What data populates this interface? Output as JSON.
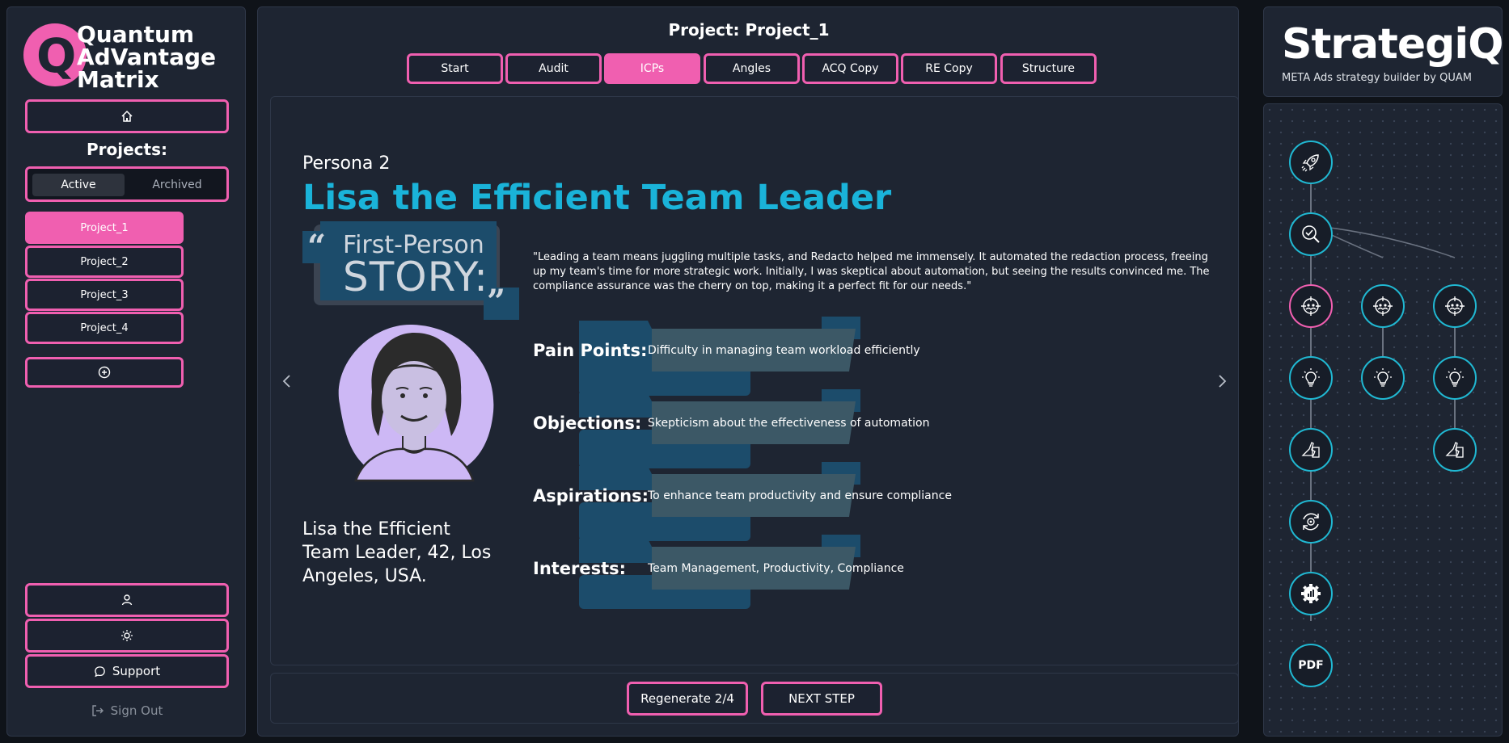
{
  "brand": {
    "line1": "Quantum",
    "line2": "AdVantage",
    "line3": "Matrix",
    "letter": "Q",
    "accent": "#f05fb0"
  },
  "sidebar": {
    "home_icon": "home-icon",
    "projects_heading": "Projects:",
    "toggle": {
      "active": "Active",
      "archived": "Archived"
    },
    "projects": [
      "Project_1",
      "Project_2",
      "Project_3",
      "Project_4"
    ],
    "add_icon": "plus-circle-icon",
    "user_icon": "user-icon",
    "theme_icon": "sun-icon",
    "support": "Support",
    "sign_out": "Sign Out"
  },
  "header": {
    "title": "Project: Project_1",
    "tabs": [
      "Start",
      "Audit",
      "ICPs",
      "Angles",
      "ACQ Copy",
      "RE Copy",
      "Structure"
    ],
    "active_tab": "ICPs"
  },
  "persona": {
    "number_label": "Persona 2",
    "name": "Lisa the Efficient Team Leader",
    "story_top": "First-Person",
    "story_bottom": "STORY:",
    "quote": "\"Leading a team means juggling multiple tasks, and Redacto helped me immensely. It automated the redaction process, freeing up my team's time for more strategic work. Initially, I was skeptical about automation, but seeing the results convinced me. The compliance assurance was the cherry on top, making it a perfect fit for our needs.\"",
    "caption": "Lisa the Efficient Team Leader, 42, Los Angeles, USA.",
    "rows": [
      {
        "label": "Pain Points:",
        "value": "Difficulty in managing team workload efficiently"
      },
      {
        "label": "Objections:",
        "value": "Skepticism about the effectiveness of automation"
      },
      {
        "label": "Aspirations:",
        "value": "To enhance team productivity and ensure compliance"
      },
      {
        "label": "Interests:",
        "value": "Team Management, Productivity, Compliance"
      }
    ]
  },
  "footer": {
    "regenerate": "Regenerate 2/4",
    "next": "NEXT STEP"
  },
  "right": {
    "logo": "StrategiQ",
    "tagline": "META Ads strategy builder by QUAM",
    "pdf_label": "PDF",
    "accent_cyan": "#20b8d2"
  }
}
